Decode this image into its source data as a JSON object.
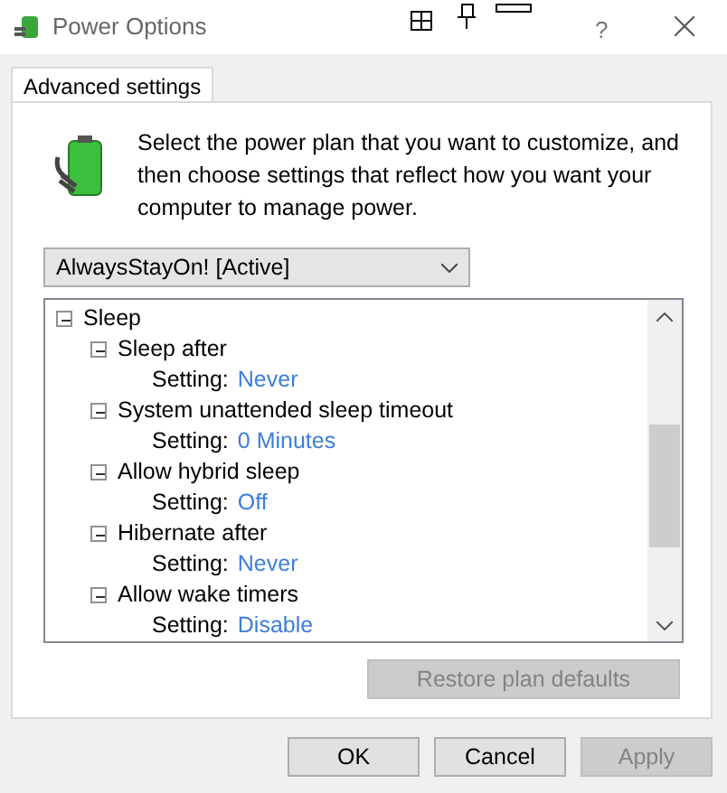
{
  "window": {
    "title": "Power Options",
    "help": "?"
  },
  "tabs": [
    {
      "label": "Advanced settings",
      "selected": true
    }
  ],
  "description": "Select the power plan that you want to customize, and then choose settings that reflect how you want your computer to manage power.",
  "plan_dropdown": {
    "value": "AlwaysStayOn! [Active]"
  },
  "tree": [
    {
      "label": "Sleep",
      "expanded": true,
      "children": [
        {
          "label": "Sleep after",
          "expanded": true,
          "setting": {
            "label": "Setting:",
            "value": "Never"
          }
        },
        {
          "label": "System unattended sleep timeout",
          "expanded": true,
          "setting": {
            "label": "Setting:",
            "value": "0 Minutes"
          }
        },
        {
          "label": "Allow hybrid sleep",
          "expanded": true,
          "setting": {
            "label": "Setting:",
            "value": "Off"
          }
        },
        {
          "label": "Hibernate after",
          "expanded": true,
          "setting": {
            "label": "Setting:",
            "value": "Never"
          }
        },
        {
          "label": "Allow wake timers",
          "expanded": true,
          "setting": {
            "label": "Setting:",
            "value": "Disable"
          }
        }
      ]
    }
  ],
  "restore_button": {
    "label": "Restore plan defaults",
    "disabled": true
  },
  "buttons": [
    {
      "label": "OK",
      "disabled": false
    },
    {
      "label": "Cancel",
      "disabled": false
    },
    {
      "label": "Apply",
      "disabled": true
    }
  ]
}
